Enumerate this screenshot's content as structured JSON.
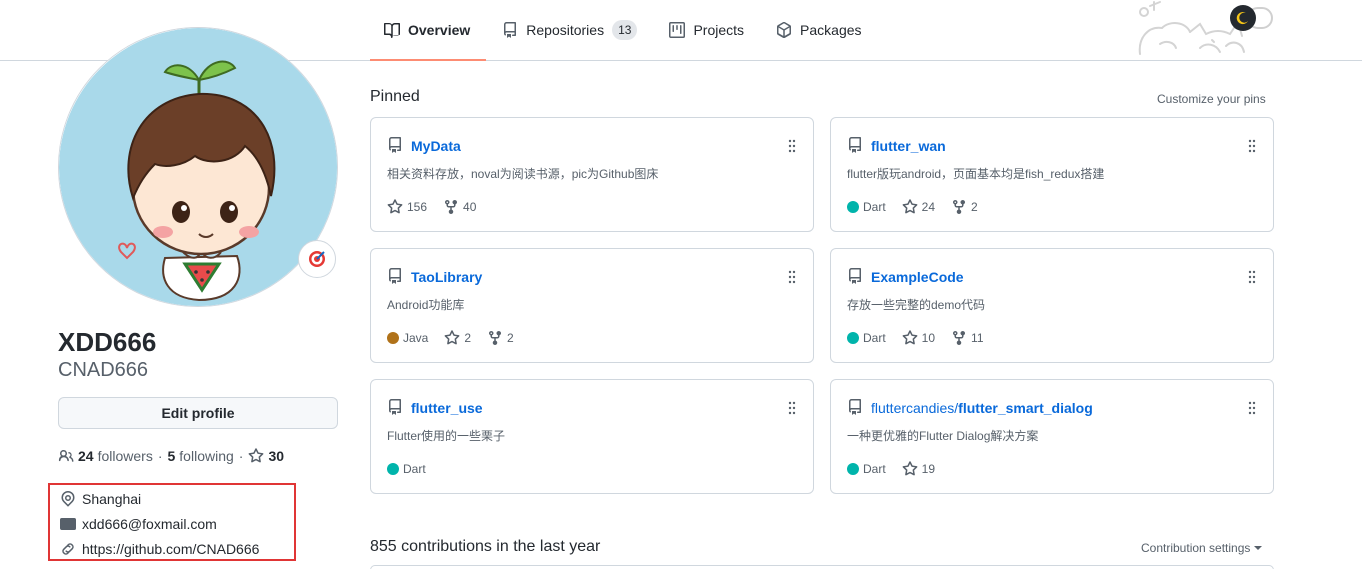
{
  "tabs": [
    {
      "label": "Overview",
      "icon": "book-icon",
      "active": true
    },
    {
      "label": "Repositories",
      "icon": "repo-icon",
      "count": "13"
    },
    {
      "label": "Projects",
      "icon": "project-icon"
    },
    {
      "label": "Packages",
      "icon": "package-icon"
    }
  ],
  "profile": {
    "name": "XDD666",
    "login": "CNAD666",
    "edit_label": "Edit profile",
    "followers_count": "24",
    "followers_label": "followers",
    "following_count": "5",
    "following_label": "following",
    "stars_count": "30",
    "separator": "·",
    "location": "Shanghai",
    "email": "xdd666@foxmail.com",
    "website": "https://github.com/CNAD666"
  },
  "pinned": {
    "title": "Pinned",
    "customize_label": "Customize your pins",
    "cards": [
      {
        "name": "MyData",
        "description": "相关资料存放，noval为阅读书源，pic为Github图床",
        "language": "",
        "stars": "156",
        "forks": "40"
      },
      {
        "name": "flutter_wan",
        "description": "flutter版玩android，页面基本均是fish_redux搭建",
        "language": "Dart",
        "stars": "24",
        "forks": "2"
      },
      {
        "name": "TaoLibrary",
        "description": "Android功能库",
        "language": "Java",
        "stars": "2",
        "forks": "2"
      },
      {
        "name": "ExampleCode",
        "description": "存放一些完整的demo代码",
        "language": "Dart",
        "stars": "10",
        "forks": "11"
      },
      {
        "name": "flutter_use",
        "description": "Flutter使用的一些栗子",
        "language": "Dart",
        "stars": "",
        "forks": ""
      },
      {
        "owner": "fluttercandies/",
        "name": "flutter_smart_dialog",
        "description": "一种更优雅的Flutter Dialog解决方案",
        "language": "Dart",
        "stars": "19",
        "forks": ""
      }
    ]
  },
  "languages": {
    "Dart": "#00B4AB",
    "Java": "#b07219"
  },
  "contributions": {
    "title": "855 contributions in the last year",
    "settings_label": "Contribution settings"
  },
  "colors": {
    "accent": "#fd8c73",
    "link": "#0969da",
    "highlight_box": "#e03535"
  }
}
